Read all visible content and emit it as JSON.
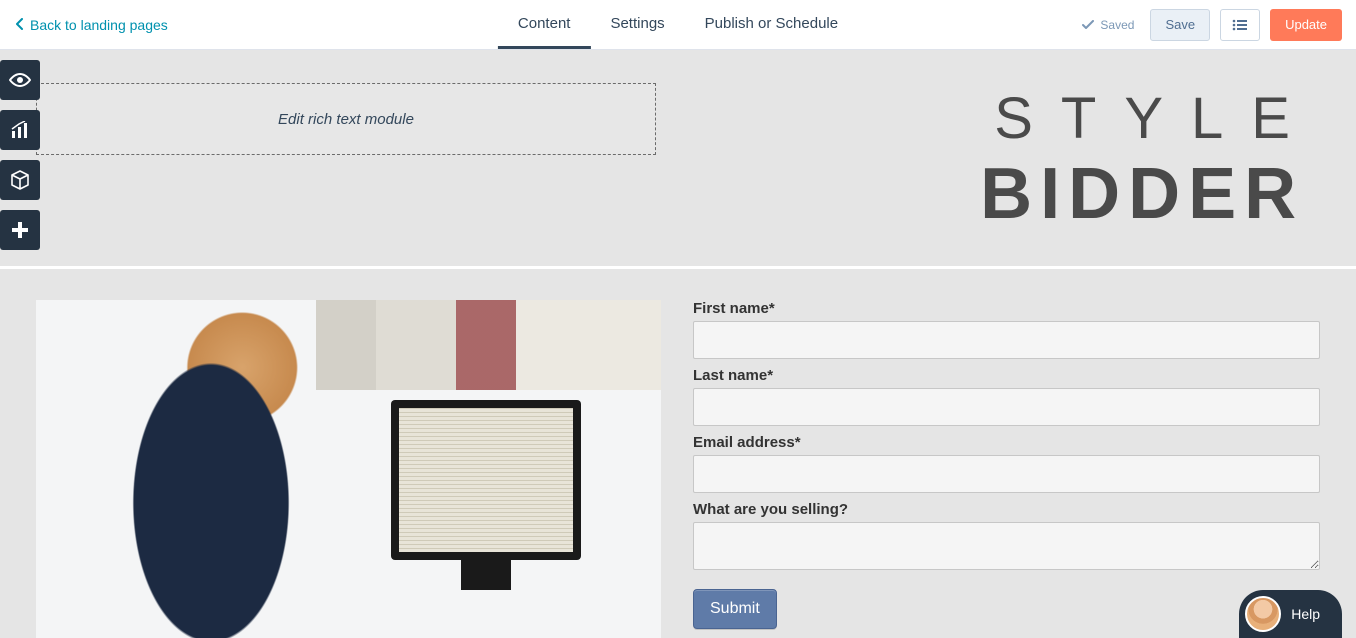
{
  "header": {
    "back_label": "Back to landing pages",
    "tabs": [
      "Content",
      "Settings",
      "Publish or Schedule"
    ],
    "saved_label": "Saved",
    "save_label": "Save",
    "update_label": "Update"
  },
  "sidebar_icons": [
    "eye-icon",
    "chart-icon",
    "box-icon",
    "plus-icon"
  ],
  "canvas": {
    "rich_text_placeholder": "Edit rich text module",
    "logo_line1": "STYLE",
    "logo_line2": "BIDDER"
  },
  "form": {
    "fields": [
      {
        "label": "First name*",
        "type": "text"
      },
      {
        "label": "Last name*",
        "type": "text"
      },
      {
        "label": "Email address*",
        "type": "text"
      },
      {
        "label": "What are you selling?",
        "type": "textarea"
      }
    ],
    "submit_label": "Submit"
  },
  "help": {
    "label": "Help"
  }
}
